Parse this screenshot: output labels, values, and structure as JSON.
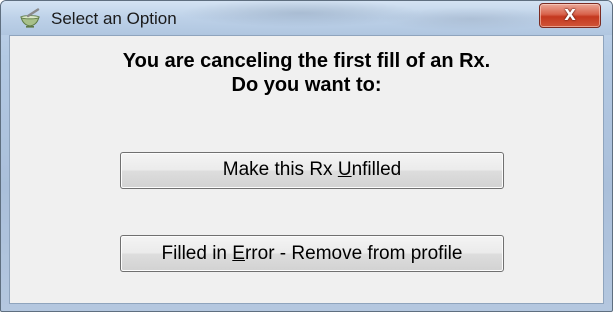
{
  "window": {
    "title": "Select an Option",
    "app_icon": "mortar-pestle-icon",
    "close_glyph": "X"
  },
  "dialog": {
    "message_line1": "You are canceling the first fill of an Rx.",
    "message_line2": "Do you want to:"
  },
  "buttons": {
    "unfilled": {
      "label_before": "Make this Rx ",
      "mnemonic": "U",
      "label_after": "nfilled"
    },
    "remove": {
      "label_before": "Filled in ",
      "mnemonic": "E",
      "label_after": "rror - Remove from profile"
    }
  },
  "colors": {
    "close_button": "#c4381f",
    "client_background": "#f0f0f0"
  }
}
